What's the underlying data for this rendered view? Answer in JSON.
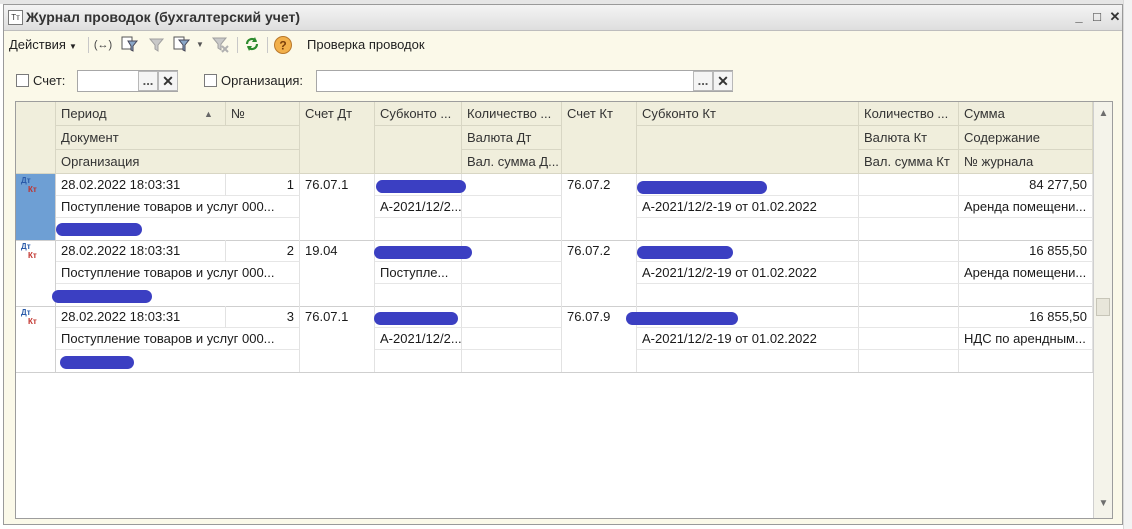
{
  "window": {
    "title": "Журнал проводок (бухгалтерский учет)",
    "minimize": "_",
    "maximize": "□",
    "close": "✕"
  },
  "toolbar": {
    "actions_label": "Действия",
    "check_label": "Проверка проводок",
    "icons": [
      "arrows-icon",
      "filter-icon",
      "filter-disabled-icon",
      "filter-dropdown-icon",
      "filter-clear-icon",
      "refresh-icon",
      "help-icon"
    ]
  },
  "filters": {
    "account_label": "Счет:",
    "account_value": "",
    "org_label": "Организация:",
    "org_value": "",
    "select_button": "...",
    "clear_button": "✕"
  },
  "table": {
    "headers": {
      "period": "Период",
      "number": "№",
      "account_dt": "Счет Дт",
      "subkonto_dt": "Субконто ...",
      "quantity_dt": "Количество ...",
      "account_kt": "Счет Кт",
      "subkonto_kt": "Субконто Кт",
      "quantity_kt": "Количество ...",
      "sum": "Сумма",
      "document": "Документ",
      "currency_dt": "Валюта Дт",
      "currency_kt": "Валюта Кт",
      "content": "Содержание",
      "organization": "Организация",
      "cur_sum_dt": "Вал. сумма Д...",
      "cur_sum_kt": "Вал. сумма Кт",
      "journal_no": "№ журнала"
    },
    "rows": [
      {
        "period": "28.02.2022 18:03:31",
        "number": "1",
        "account_dt": "76.07.1",
        "document": "Поступление товаров и услуг 000...",
        "subkonto_dt2": "А-2021/12/2...",
        "account_kt": "76.07.2",
        "subkonto_kt2": "А-2021/12/2-19 от 01.02.2022",
        "sum": "84 277,50",
        "content": "Аренда помещени..."
      },
      {
        "period": "28.02.2022 18:03:31",
        "number": "2",
        "account_dt": "19.04",
        "document": "Поступление товаров и услуг 000...",
        "subkonto_dt2": "Поступле...",
        "account_kt": "76.07.2",
        "subkonto_kt2": "А-2021/12/2-19 от 01.02.2022",
        "sum": "16 855,50",
        "content": "Аренда помещени..."
      },
      {
        "period": "28.02.2022 18:03:31",
        "number": "3",
        "account_dt": "76.07.1",
        "document": "Поступление товаров и услуг 000...",
        "subkonto_dt2": "А-2021/12/2...",
        "account_kt": "76.07.9",
        "subkonto_kt2": "А-2021/12/2-19 от 01.02.2022",
        "sum": "16 855,50",
        "content": "НДС по арендным..."
      }
    ],
    "row_badge_dt": "Дт",
    "row_badge_kt": "Кт"
  },
  "scroll": {
    "up": "▲",
    "down": "▼"
  }
}
